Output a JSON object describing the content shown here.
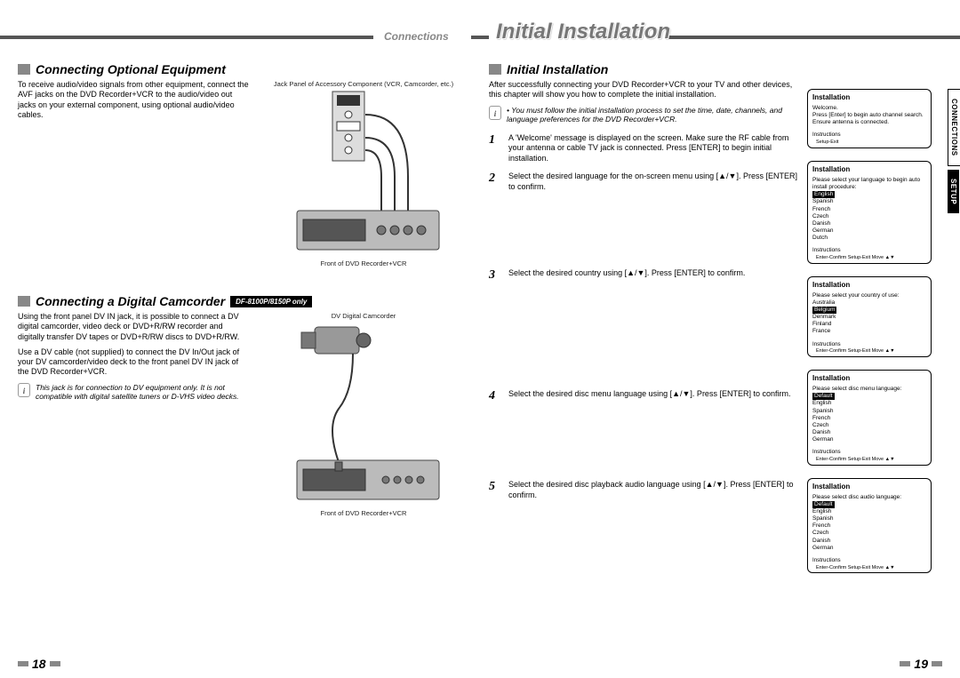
{
  "header": {
    "left_label": "Connections",
    "right_label": "Initial Installation"
  },
  "side_tabs": {
    "connections": "CONNECTIONS",
    "setup": "SETUP"
  },
  "left_page": {
    "sec1_title": "Connecting Optional Equipment",
    "sec1_body": "To receive audio/video signals from other equipment, connect the AVF jacks on the DVD Recorder+VCR to the audio/video out jacks on your external component, using optional audio/video cables.",
    "fig1_caption_top": "Jack Panel of Accessory Component (VCR, Camcorder, etc.)",
    "fig1_caption_bottom": "Front of DVD Recorder+VCR",
    "sec2_title": "Connecting a Digital Camcorder",
    "sec2_badge": "DF-8100P/8150P only",
    "sec2_body1": "Using the front panel DV IN jack, it is possible to connect a DV digital camcorder, video deck or DVD+R/RW recorder and digitally transfer DV tapes or DVD+R/RW discs to DVD+R/RW.",
    "sec2_body2": "Use a DV cable (not supplied) to connect the DV In/Out jack of your DV camcorder/video deck to the front panel DV IN jack of the DVD Recorder+VCR.",
    "sec2_note": "This jack is for connection to DV equipment only. It is not compatible with digital satellite tuners or D-VHS video decks.",
    "fig2_caption_top": "DV Digital Camcorder",
    "fig2_caption_bottom": "Front of DVD Recorder+VCR",
    "page_num": "18"
  },
  "right_page": {
    "sec_title": "Initial Installation",
    "intro": "After successfully connecting your DVD Recorder+VCR to your TV and other devices, this chapter will show you how to complete the initial installation.",
    "note": "You must follow the initial installation process to set the time, date, channels, and language preferences for the DVD Recorder+VCR.",
    "steps": [
      {
        "num": "1",
        "txt": "A 'Welcome' message is displayed on the screen. Make sure the RF cable from your antenna or cable TV jack is connected. Press [ENTER] to begin initial installation."
      },
      {
        "num": "2",
        "txt": "Select the desired language for the on-screen menu using [▲/▼]. Press [ENTER] to confirm."
      },
      {
        "num": "3",
        "txt": "Select the desired country using [▲/▼]. Press [ENTER] to confirm."
      },
      {
        "num": "4",
        "txt": "Select the desired disc menu language using [▲/▼]. Press [ENTER] to confirm."
      },
      {
        "num": "5",
        "txt": "Select the desired disc playback audio language using [▲/▼]. Press [ENTER] to confirm."
      }
    ],
    "ui_boxes": [
      {
        "title": "Installation",
        "lines": [
          "Welcome.",
          "Press [Enter] to begin auto channel search.",
          "Ensure antenna is connected."
        ],
        "instr": "Instructions",
        "footer": "Setup-Exit"
      },
      {
        "title": "Installation",
        "pre": "Please select your language to begin auto install procedure:",
        "items": [
          "English",
          "Spanish",
          "French",
          "Czech",
          "Danish",
          "German",
          "Dutch"
        ],
        "hl": 0,
        "instr": "Instructions",
        "footer": "Enter-Confirm   Setup-Exit   Move ▲▼"
      },
      {
        "title": "Installation",
        "pre": "Please select your country of use:",
        "items": [
          "Australia",
          "Belgium",
          "Denmark",
          "Finland",
          "France"
        ],
        "hl": 1,
        "instr": "Instructions",
        "footer": "Enter-Confirm   Setup-Exit   Move ▲▼"
      },
      {
        "title": "Installation",
        "pre": "Please select disc menu language:",
        "items": [
          "Default",
          "English",
          "Spanish",
          "French",
          "Czech",
          "Danish",
          "German"
        ],
        "hl": 0,
        "instr": "Instructions",
        "footer": "Enter-Confirm   Setup-Exit   Move ▲▼"
      },
      {
        "title": "Installation",
        "pre": "Please select disc audio language:",
        "items": [
          "Default",
          "English",
          "Spanish",
          "French",
          "Czech",
          "Danish",
          "German"
        ],
        "hl": 0,
        "instr": "Instructions",
        "footer": "Enter-Confirm   Setup-Exit   Move ▲▼"
      }
    ],
    "page_num": "19"
  }
}
